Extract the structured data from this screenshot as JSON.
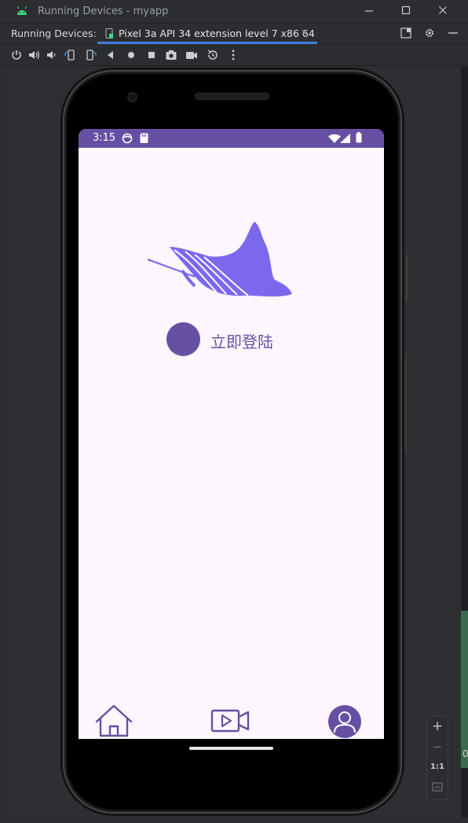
{
  "window": {
    "title": "Running Devices - myapp",
    "app_icon": "android-icon"
  },
  "tabbar": {
    "label": "Running Devices:",
    "tab_label": "Pixel 3a API 34 extension level 7 x86 64",
    "tab_close": "×",
    "accent_color": "#3d7fe0"
  },
  "toolbar": {
    "icons": [
      "power-icon",
      "volume-up-icon",
      "volume-down-icon",
      "rotate-left-icon",
      "rotate-right-icon",
      "back-icon",
      "home-icon",
      "overview-icon",
      "screenshot-icon",
      "screen-record-icon",
      "snapshot-icon",
      "more-icon"
    ]
  },
  "device": {
    "status_time": "3:15",
    "status_color": "#6750a4",
    "screen_background": "#fef7ff",
    "login_label": "立即登陆",
    "brand_color": "#6750a4",
    "logo_color": "#7b68ee",
    "nav_items": [
      "home-icon",
      "video-icon",
      "profile-icon"
    ]
  },
  "zoom": {
    "zoom_in": "+",
    "zoom_out": "−",
    "actual_size": "1:1",
    "fit": "fit-screen-icon"
  },
  "edge_label": "0"
}
